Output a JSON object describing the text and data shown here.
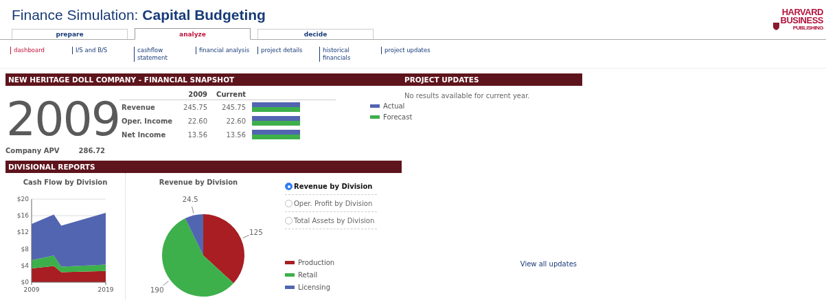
{
  "header": {
    "title_plain": "Finance Simulation:",
    "title_bold": "Capital Budgeting",
    "logo": [
      "HARVARD",
      "BUSINESS",
      "PUBLISHING"
    ]
  },
  "tabs": [
    {
      "label": "prepare",
      "selected": false
    },
    {
      "label": "analyze",
      "selected": true
    },
    {
      "label": "decide",
      "selected": false
    }
  ],
  "subnav": [
    {
      "label": "dashboard",
      "selected": true
    },
    {
      "label": "I/S and B/S",
      "selected": false
    },
    {
      "label": "cashflow\nstatement",
      "selected": false
    },
    {
      "label": "financial analysis",
      "selected": false
    },
    {
      "label": "project details",
      "selected": false
    },
    {
      "label": "historical\nfinancials",
      "selected": false
    },
    {
      "label": "project updates",
      "selected": false
    }
  ],
  "snapshot": {
    "title": "NEW HERITAGE DOLL COMPANY - FINANCIAL SNAPSHOT",
    "year": "2009",
    "apv_label": "Company APV",
    "apv_value": "286.72",
    "columns": [
      "2009",
      "Current"
    ],
    "rows": [
      {
        "label": "Revenue",
        "values": [
          "245.75",
          "245.75"
        ],
        "bars": [
          {
            "level": 1
          },
          {
            "level": 1
          }
        ]
      },
      {
        "label": "Oper. Income",
        "values": [
          "22.60",
          "22.60"
        ],
        "bars": [
          {
            "level": 1
          },
          {
            "level": 1
          }
        ]
      },
      {
        "label": "Net Income",
        "values": [
          "13.56",
          "13.56"
        ],
        "bars": [
          {
            "level": 1
          },
          {
            "level": 1
          }
        ]
      }
    ],
    "legend": [
      {
        "label": "Actual",
        "color": "#5265b1"
      },
      {
        "label": "Forecast",
        "color": "#3db04b"
      }
    ]
  },
  "divisional": {
    "title": "DIVISIONAL REPORTS",
    "cashflow_chart": {
      "chart_data": {
        "type": "area",
        "title": "Cash Flow by Division",
        "x": [
          2009,
          2012,
          2013,
          2019
        ],
        "stacked": true,
        "xlim": [
          2009,
          2019
        ],
        "ylim": [
          0,
          20
        ],
        "yticks": [
          {
            "value": 0,
            "label": "$0"
          },
          {
            "value": 4,
            "label": "$4"
          },
          {
            "value": 8,
            "label": "$8"
          },
          {
            "value": 12,
            "label": "$12"
          },
          {
            "value": 16,
            "label": "$16"
          },
          {
            "value": 20,
            "label": "$20"
          }
        ],
        "xticks": [
          2009,
          2019
        ],
        "series": [
          {
            "color": "#a81e22",
            "values": [
              3.3,
              3.9,
              2.4,
              2.7
            ]
          },
          {
            "color": "#3db04b",
            "values": [
              2.0,
              2.5,
              1.3,
              1.5
            ]
          },
          {
            "color": "#5265b1",
            "values": [
              8.7,
              9.9,
              9.9,
              12.5
            ]
          }
        ]
      }
    },
    "revenue_chart": {
      "chart_data": {
        "type": "pie",
        "title": "Revenue by Division",
        "categories": [
          "Production",
          "Retail",
          "Licensing"
        ],
        "values": [
          125,
          190,
          24.5
        ],
        "data_labels": true,
        "value_labels": [
          "125",
          "190",
          "24.5"
        ]
      }
    },
    "options": [
      {
        "label": "Revenue by Division",
        "selected": true
      },
      {
        "label": "Oper. Profit by Division",
        "selected": false
      },
      {
        "label": "Total Assets by Division",
        "selected": false
      }
    ]
  },
  "project_updates": {
    "title": "PROJECT UPDATES",
    "message": "No results available for current year.",
    "link": "View all updates"
  }
}
